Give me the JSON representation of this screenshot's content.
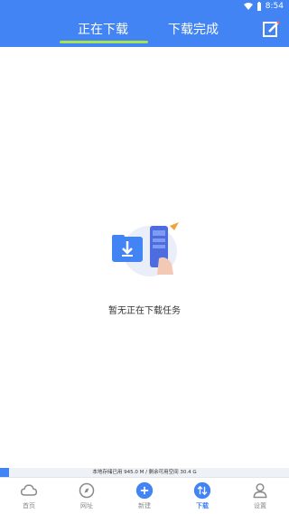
{
  "status_bar": {
    "time": "8:54"
  },
  "tabs": [
    {
      "label": "正在下载",
      "active": true
    },
    {
      "label": "下载完成",
      "active": false
    }
  ],
  "empty_state": {
    "message": "暂无正在下载任务"
  },
  "storage": {
    "text": "本地存储已用 945.0 M / 剩余可用空间 30.4 G",
    "used_fraction": 0.03
  },
  "bottom_nav": {
    "items": [
      {
        "label": "首页",
        "icon": "cloud-icon",
        "active": false
      },
      {
        "label": "网址",
        "icon": "compass-icon",
        "active": false
      },
      {
        "label": "新建",
        "icon": "plus-icon",
        "active": false
      },
      {
        "label": "下载",
        "icon": "download-sort-icon",
        "active": true
      },
      {
        "label": "设置",
        "icon": "user-icon",
        "active": false
      }
    ]
  },
  "colors": {
    "primary": "#4284f3",
    "accent_underline": "#a7e34c"
  }
}
